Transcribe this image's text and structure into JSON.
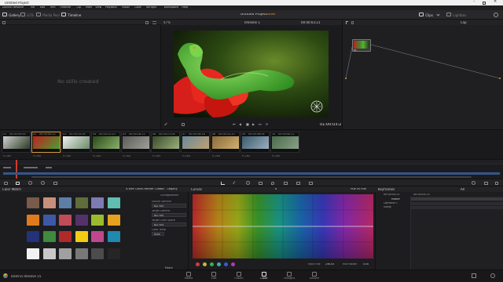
{
  "window": {
    "title": "Untitled Project",
    "controls": [
      "minimize",
      "maximize",
      "close"
    ]
  },
  "menu": {
    "items": [
      "DaVinci Resolve",
      "File",
      "Edit",
      "Trim",
      "Timeline",
      "Clip",
      "Mark",
      "View",
      "Playback",
      "Fusion",
      "Color",
      "Fairlight",
      "Workspace",
      "Help"
    ]
  },
  "toolbar": {
    "gallery": "Gallery",
    "luts": "LUTs",
    "media_pool": "Media Pool",
    "timeline": "Timeline",
    "project_title": "Untitled Project",
    "project_status": "Edited",
    "clips": "Clips",
    "lightbox": "Lightbox"
  },
  "gallery": {
    "empty_text": "No stills created"
  },
  "viewer": {
    "zoom": "47%",
    "timeline_name": "Timeline 1",
    "source_tc": "00:00:03:21",
    "timecode": "01:00:03:21"
  },
  "node_editor": {
    "mode": "Clip",
    "node_label": "01"
  },
  "clips": [
    {
      "num": "01",
      "tc": "00:00:00:00",
      "codec": "H.264"
    },
    {
      "num": "02",
      "tc": "00:00:00:12",
      "codec": "H.264"
    },
    {
      "num": "03",
      "tc": "00:00:10:04",
      "codec": "H.264"
    },
    {
      "num": "04",
      "tc": "00:00:12:20",
      "codec": "H.264"
    },
    {
      "num": "05",
      "tc": "00:00:18:12",
      "codec": "H.264"
    },
    {
      "num": "06",
      "tc": "00:00:21:04",
      "codec": "H.264"
    },
    {
      "num": "07",
      "tc": "00:00:26:18",
      "codec": "H.264"
    },
    {
      "num": "08",
      "tc": "00:00:32:20",
      "codec": "H.264"
    },
    {
      "num": "09",
      "tc": "00:00:36:04",
      "codec": "H.264"
    },
    {
      "num": "10",
      "tc": "00:00:40:11",
      "codec": "H.264"
    }
  ],
  "color_match": {
    "title": "Color Match",
    "chart": "X-Rite ColorChecker Classic - Legacy",
    "configuration": "Configuration",
    "source_gamma_label": "Source Gamma",
    "source_gamma": "Rec.709",
    "target_gamma_label": "Target Gamma",
    "target_gamma": "Rec.709",
    "target_color_space_label": "Target Color Space",
    "target_color_space": "Rec.709",
    "color_temp_label": "Color Temp",
    "color_temp": "6500",
    "match_button": "Match",
    "swatches": [
      "#7a5a4a",
      "#c8907a",
      "#5d7fa6",
      "#5e6d3a",
      "#7d7bb4",
      "#5fbfb0",
      "#e07a1e",
      "#3e58a8",
      "#c04c5a",
      "#55316a",
      "#9cbb2c",
      "#e6a11e",
      "#24327a",
      "#3e8a3e",
      "#b02a2a",
      "#f2cc14",
      "#c0478e",
      "#1f89b0",
      "#f2f2f2",
      "#c8c8c8",
      "#a0a0a0",
      "#787878",
      "#4c4c4c",
      "#262626"
    ]
  },
  "curves": {
    "title": "Curves",
    "hue_vs": "Hue Vs Hue",
    "input_hue_label": "Input Hue",
    "input_hue": "256.00",
    "hue_rotate_label": "Hue Rotate",
    "hue_rotate": "0.00"
  },
  "keyframes": {
    "title": "Keyframes",
    "tc": "00:00:03:21",
    "all": "All",
    "master": "Master",
    "corrector": "Corrector 1",
    "sizing": "Sizing",
    "tc2": "00:00:03:13"
  },
  "pages": [
    "Media",
    "Edit",
    "Fusion",
    "Color",
    "Fairlight",
    "Deliver"
  ],
  "active_page": "Color",
  "footer": {
    "app": "DaVinci Resolve 15"
  }
}
